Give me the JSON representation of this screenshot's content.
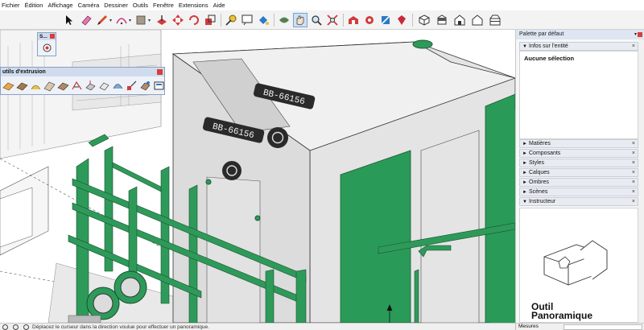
{
  "menu": [
    "Fichier",
    "Édition",
    "Affichage",
    "Caméra",
    "Dessiner",
    "Outils",
    "Fenêtre",
    "Extensions",
    "Aide"
  ],
  "toolbar": {
    "buttons": [
      "select-tool",
      "eraser-tool",
      "pencil-line-tool",
      "arc-tool",
      "rectangle-tool",
      "push-pull-tool",
      "move-tool",
      "rotate-tool",
      "scale-tool",
      "follow-me-tool",
      "tape-measure-tool",
      "text-tool",
      "paint-bucket-tool",
      "orbit-tool",
      "pan-tool",
      "zoom-tool",
      "zoom-extents-tool",
      "warehouse-tool",
      "extension-warehouse-tool",
      "layout-tool",
      "ruby-tool",
      "iso-view-tool",
      "top-view-tool",
      "front-view-tool",
      "right-view-tool",
      "back-view-tool"
    ]
  },
  "float_small": {
    "title": "S..."
  },
  "extrusion_toolbar": {
    "title": "utils d'extrusion",
    "button_count": 12
  },
  "model": {
    "plate_text": "BB-66156"
  },
  "panel": {
    "title": "Palette par défaut",
    "entity_section": "Infos sur l'entité",
    "entity_status": "Aucune sélection",
    "sections": [
      "Matières",
      "Composants",
      "Styles",
      "Calques",
      "Ombres",
      "Scènes"
    ],
    "instructor_section": "Instructeur",
    "instructor_title_line1": "Outil",
    "instructor_title_line2": "Panoramique"
  },
  "statusbar": {
    "message": "Déplacez le curseur dans la direction voulue pour effectuer un panoramique.",
    "measure_label": "Mesures"
  },
  "colors": {
    "railing_green": "#2e9a5a",
    "panel_green": "#2a9a58",
    "body_grey": "#e4e4e4"
  }
}
